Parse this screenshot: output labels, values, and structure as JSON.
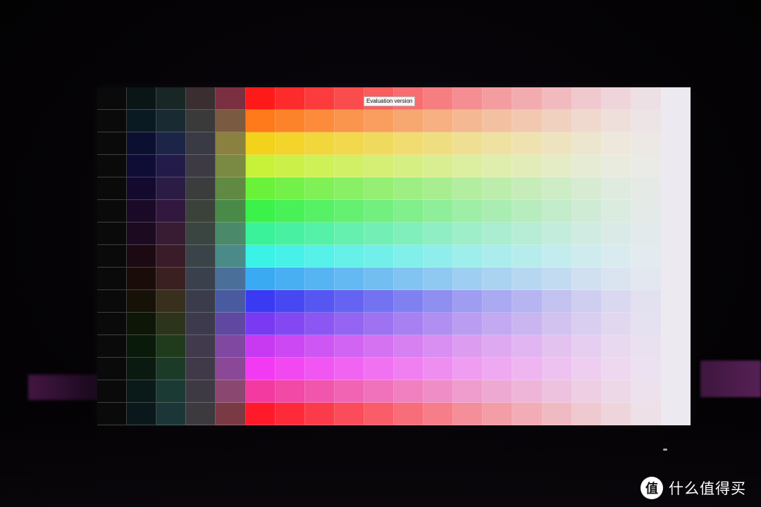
{
  "photo": {
    "subject": "monitor-color-test-pattern",
    "background_color": "#050306",
    "ambient_glow_color": "#7a2a7a"
  },
  "screen": {
    "watermark_text": "Evaluation version",
    "columns": 20,
    "rows": 15,
    "column_labels": [
      "",
      "",
      "",
      "",
      "",
      "",
      "",
      "",
      "",
      "",
      "",
      "",
      "",
      "",
      "",
      "",
      "",
      "",
      "",
      ""
    ],
    "row_labels": [
      "",
      "",
      "",
      "",
      "",
      "",
      "",
      "",
      "",
      "",
      "",
      "",
      "",
      "",
      ""
    ],
    "column_fade_levels": [
      0.0,
      0.0,
      0.0,
      0.0,
      0.0,
      0.0,
      0.08,
      0.16,
      0.24,
      0.32,
      0.4,
      0.48,
      0.56,
      0.63,
      0.7,
      0.77,
      0.84,
      0.9,
      0.95,
      1.0
    ],
    "row_hues": [
      "#ff1a1a",
      "#ff7a1a",
      "#f2d21a",
      "#c8f23a",
      "#6af23a",
      "#3af24a",
      "#3af29a",
      "#3af2e6",
      "#3aaaf2",
      "#3a3af2",
      "#7a3af2",
      "#c83af2",
      "#f23af2",
      "#f23aa0",
      "#ff1a2a"
    ],
    "dark_column_tints": [
      [
        "#0a0a0a",
        "#0a1516",
        "#182626",
        "#3a2e31",
        "#7a3040"
      ],
      [
        "#0a0a0a",
        "#0a1a22",
        "#1a2a33",
        "#3a3a3a",
        "#7a5a40"
      ],
      [
        "#0a0a0a",
        "#0c1030",
        "#1c2448",
        "#3a3a44",
        "#8a8040"
      ],
      [
        "#0a0a0a",
        "#0f0c36",
        "#231c4a",
        "#3d3a44",
        "#7a8a42"
      ],
      [
        "#0a0a0a",
        "#140a2e",
        "#2a1c44",
        "#3a3d3c",
        "#608a44"
      ],
      [
        "#0a0a0a",
        "#1a0a28",
        "#32183e",
        "#3a423a",
        "#4a8a48"
      ],
      [
        "#0a0a0a",
        "#1c0a20",
        "#381c33",
        "#3a4440",
        "#4a8a6a"
      ],
      [
        "#0a0a0a",
        "#1c0a12",
        "#3a1c28",
        "#3a4448",
        "#4a8a88"
      ],
      [
        "#0a0a0a",
        "#1a0c08",
        "#3a2020",
        "#3a404c",
        "#4a709a"
      ],
      [
        "#0a0a0a",
        "#161208",
        "#38301c",
        "#3a3c4c",
        "#4a5aa0"
      ],
      [
        "#0a0a0a",
        "#0e1608",
        "#2c341c",
        "#3c3a4c",
        "#6048a0"
      ],
      [
        "#0a0a0a",
        "#0a1a0a",
        "#203a1c",
        "#403a4c",
        "#8048a0"
      ],
      [
        "#0a0a0a",
        "#0a1a10",
        "#1c3a28",
        "#403a48",
        "#8a4896"
      ],
      [
        "#0a0a0a",
        "#0a1a18",
        "#1c3a34",
        "#3e3a44",
        "#8a4870"
      ],
      [
        "#0a0a0a",
        "#0a181c",
        "#1c3638",
        "#3c3a3e",
        "#7a3a44"
      ]
    ]
  },
  "brand": {
    "logo_glyph": "值",
    "name": "什么值得买"
  }
}
